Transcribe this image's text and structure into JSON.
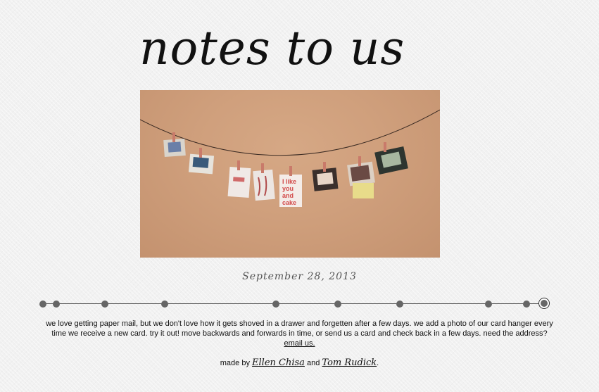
{
  "header": {
    "title": "notes to us"
  },
  "photo": {
    "card_text": [
      "I like",
      "you",
      "and",
      "cake"
    ]
  },
  "date": "September 28, 2013",
  "timeline": {
    "dot_count": 11,
    "active_index": 10
  },
  "description": {
    "text": "we love getting paper mail, but we don't love how it gets shoved in a drawer and forgetten after a few days. we add a photo of our card hanger every time we receive a new card. try it out! move backwards and forwards in time, or send us a card and check back in a few days. need the address?",
    "link": "email us."
  },
  "credit": {
    "prefix": "made by",
    "name1": "Ellen Chisa",
    "conjunction": "and",
    "name2": "Tom Rudick",
    "suffix": "."
  },
  "colors": {
    "background": "#f1f1f1",
    "photo_wall": "#cf9f7c",
    "dot": "#666666"
  }
}
